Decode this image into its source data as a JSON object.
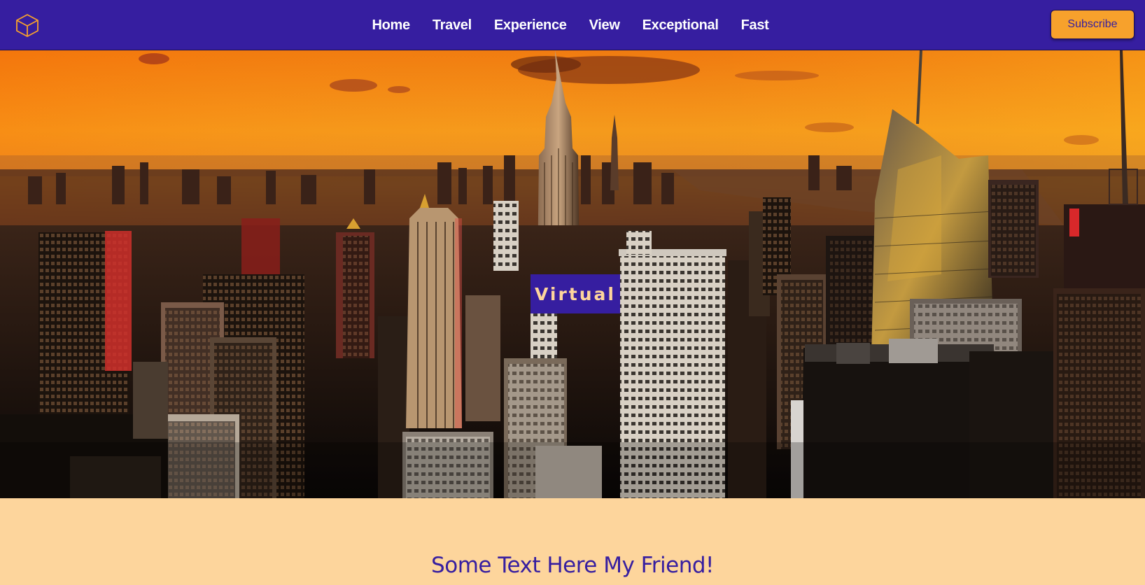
{
  "header": {
    "logo_icon": "cube-icon",
    "nav": [
      {
        "label": "Home"
      },
      {
        "label": "Travel"
      },
      {
        "label": "Experience"
      },
      {
        "label": "View"
      },
      {
        "label": "Exceptional"
      },
      {
        "label": "Fast"
      }
    ],
    "subscribe_label": "Subscribe"
  },
  "hero": {
    "image": "city-skyline-sunset",
    "badge_label": "Virtual"
  },
  "main": {
    "title": "Some Text Here My Friend!"
  },
  "colors": {
    "primary": "#361ea0",
    "accent": "#f7a12c",
    "background": "#fdd59c",
    "logo_stroke": "#f7a12c"
  }
}
